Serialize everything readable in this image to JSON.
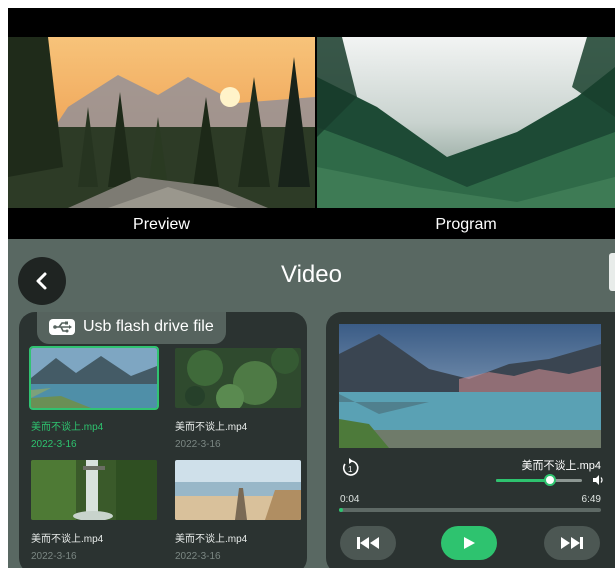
{
  "monitors": {
    "preview_label": "Preview",
    "program_label": "Program"
  },
  "header": {
    "title": "Video",
    "back_icon": "chevron-left-icon"
  },
  "usb": {
    "tab_label": "Usb flash drive file",
    "tab_icon": "usb-icon",
    "files": [
      {
        "name": "美而不谈上.mp4",
        "date": "2022-3-16",
        "selected": true
      },
      {
        "name": "美而不谈上.mp4",
        "date": "2022-3-16",
        "selected": false
      },
      {
        "name": "美而不谈上.mp4",
        "date": "2022-3-16",
        "selected": false
      },
      {
        "name": "美而不谈上.mp4",
        "date": "2022-3-16",
        "selected": false
      }
    ]
  },
  "player": {
    "now_playing": "美而不谈上.mp4",
    "current_time": "0:04",
    "total_time": "6:49",
    "seek_progress": 0.01,
    "volume_level": 0.63,
    "icons": {
      "repeat": "repeat-one-icon",
      "volume": "speaker-icon",
      "prev": "skip-previous-icon",
      "play": "play-icon",
      "next": "skip-next-icon"
    }
  },
  "colors": {
    "accent": "#2ec36f",
    "panel_bg": "#596862",
    "card_bg": "#2b3331"
  }
}
